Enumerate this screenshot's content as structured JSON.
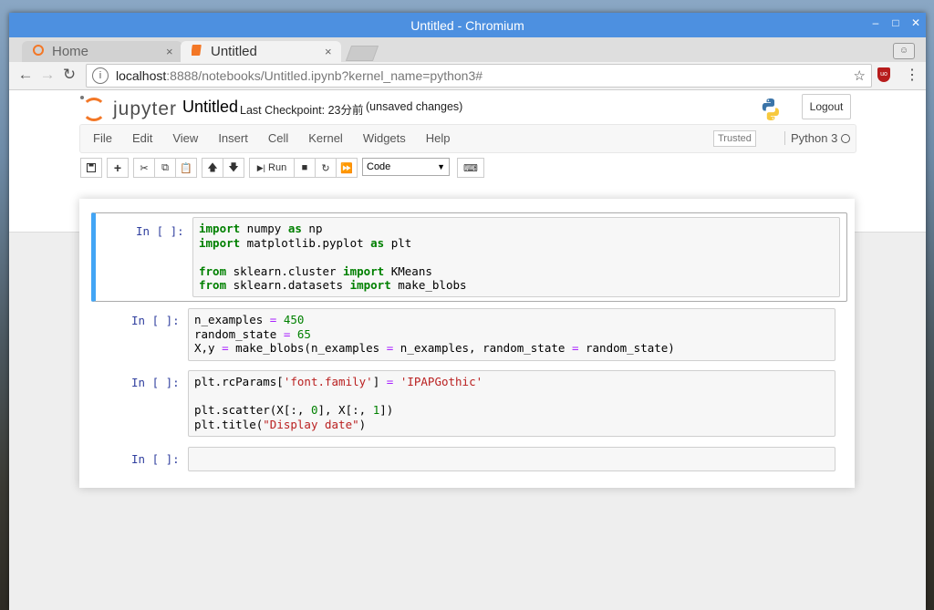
{
  "window": {
    "title": "Untitled - Chromium",
    "controls": [
      "–",
      "□",
      "✕"
    ]
  },
  "tabs": [
    {
      "label": "Home",
      "close": "×"
    },
    {
      "label": "Untitled",
      "close": "×"
    }
  ],
  "address": {
    "info": "i",
    "host": "localhost",
    "rest": ":8888/notebooks/Untitled.ipynb?kernel_name=python3#"
  },
  "jupyter": {
    "brand": "jupyter",
    "notebook_name": "Untitled",
    "checkpoint": "Last Checkpoint: 23分前",
    "status": "(unsaved changes)",
    "logout": "Logout",
    "menu": [
      "File",
      "Edit",
      "View",
      "Insert",
      "Cell",
      "Kernel",
      "Widgets",
      "Help"
    ],
    "trusted": "Trusted",
    "kernel": "Python 3",
    "run_label": "Run",
    "cell_type": "Code"
  },
  "cells": [
    {
      "prompt": "In [ ]:"
    },
    {
      "prompt": "In [ ]:"
    },
    {
      "prompt": "In [ ]:"
    },
    {
      "prompt": "In [ ]:"
    }
  ],
  "code": {
    "c1": {
      "l1": [
        "import",
        " numpy ",
        "as",
        " np"
      ],
      "l2": [
        "import",
        " matplotlib.pyplot ",
        "as",
        " plt"
      ],
      "l3": [
        "from",
        " sklearn.cluster ",
        "import",
        " KMeans"
      ],
      "l4": [
        "from",
        " sklearn.datasets ",
        "import",
        " make_blobs"
      ]
    },
    "c2": {
      "l1": [
        "n_examples ",
        "=",
        " ",
        "450"
      ],
      "l2": [
        "random_state ",
        "=",
        " ",
        "65"
      ],
      "l3": [
        "X,y ",
        "=",
        " make_blobs(n_examples ",
        "=",
        " n_examples, random_state ",
        "=",
        " random_state)"
      ]
    },
    "c3": {
      "l1": [
        "plt.rcParams[",
        "'font.family'",
        "] ",
        "=",
        " ",
        "'IPAPGothic'"
      ],
      "l2": [
        "plt.scatter(X[:, ",
        "0",
        "], X[:, ",
        "1",
        "])"
      ],
      "l3": [
        "plt.title(",
        "\"Display date\"",
        ")"
      ]
    }
  }
}
